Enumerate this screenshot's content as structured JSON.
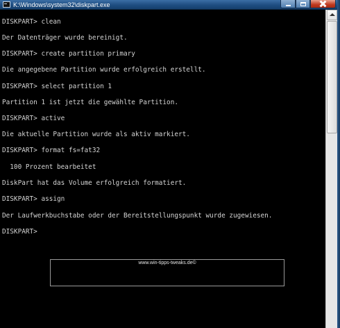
{
  "window": {
    "title": "K:\\Windows\\system32\\diskpart.exe",
    "icon": "console-app-icon",
    "controls": {
      "minimize": "minimize-icon",
      "maximize": "maximize-icon",
      "close": "close-icon"
    }
  },
  "console": {
    "lines": [
      "DISKPART> clean",
      "Der Datenträger wurde bereinigt.",
      "DISKPART> create partition primary",
      "Die angegebene Partition wurde erfolgreich erstellt.",
      "DISKPART> select partition 1",
      "Partition 1 ist jetzt die gewählte Partition.",
      "DISKPART> active",
      "Die aktuelle Partition wurde als aktiv markiert.",
      "DISKPART> format fs=fat32",
      "  100 Prozent bearbeitet",
      "DiskPart hat das Volume erfolgreich formatiert.",
      "DISKPART> assign",
      "Der Laufwerkbuchstabe oder der Bereitstellungspunkt wurde zugewiesen.",
      "DISKPART>"
    ]
  },
  "watermark": {
    "text": "www.win-tipps-tweaks.de©"
  },
  "colors": {
    "console_bg": "#000000",
    "console_text": "#d4d4d4",
    "titlebar": "#1f4e82",
    "close_button": "#c0391f"
  }
}
